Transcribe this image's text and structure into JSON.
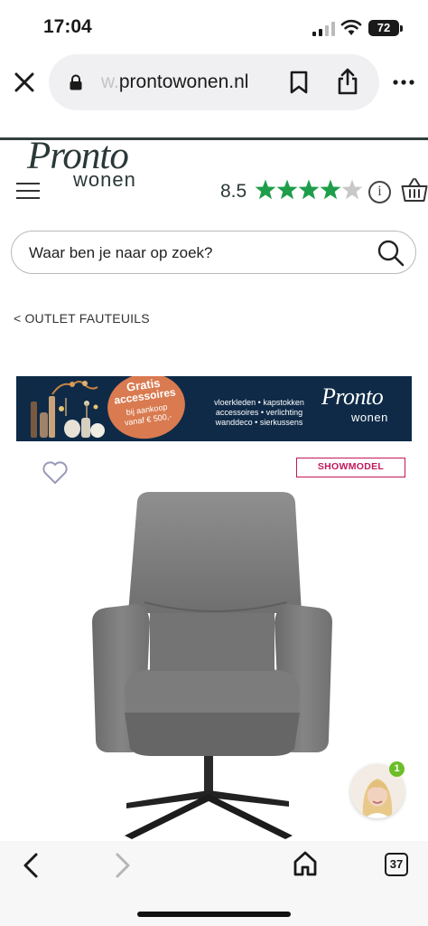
{
  "status_bar": {
    "time": "17:04",
    "battery": "72"
  },
  "browser": {
    "url_faded": "w.",
    "url_main": "prontowonen.nl"
  },
  "site": {
    "logo_top": "Pronto",
    "logo_bottom": "wonen",
    "rating": "8.5",
    "rating_stars": 4,
    "rating_max": 5,
    "info_label": "i",
    "star_color": "#1e9e4a"
  },
  "search": {
    "placeholder": "Waar ben je naar op zoek?"
  },
  "breadcrumb": {
    "label": "< OUTLET FAUTEUILS"
  },
  "banner": {
    "badge_line1": "Gratis",
    "badge_line2": "accessoires",
    "badge_line3": "bij aankoop",
    "badge_line4": "vanaf € 500,-",
    "items": [
      "vloerkleden • kapstokken",
      "accessoires • verlichting",
      "wanddeco • sierkussens"
    ],
    "logo_top": "Pronto",
    "logo_bottom": "wonen",
    "background": "#0f2a47",
    "badge_color": "#d97a50"
  },
  "product": {
    "badge": "SHOWMODEL"
  },
  "chat": {
    "unread": "1"
  },
  "bottom_bar": {
    "tab_count": "37"
  }
}
